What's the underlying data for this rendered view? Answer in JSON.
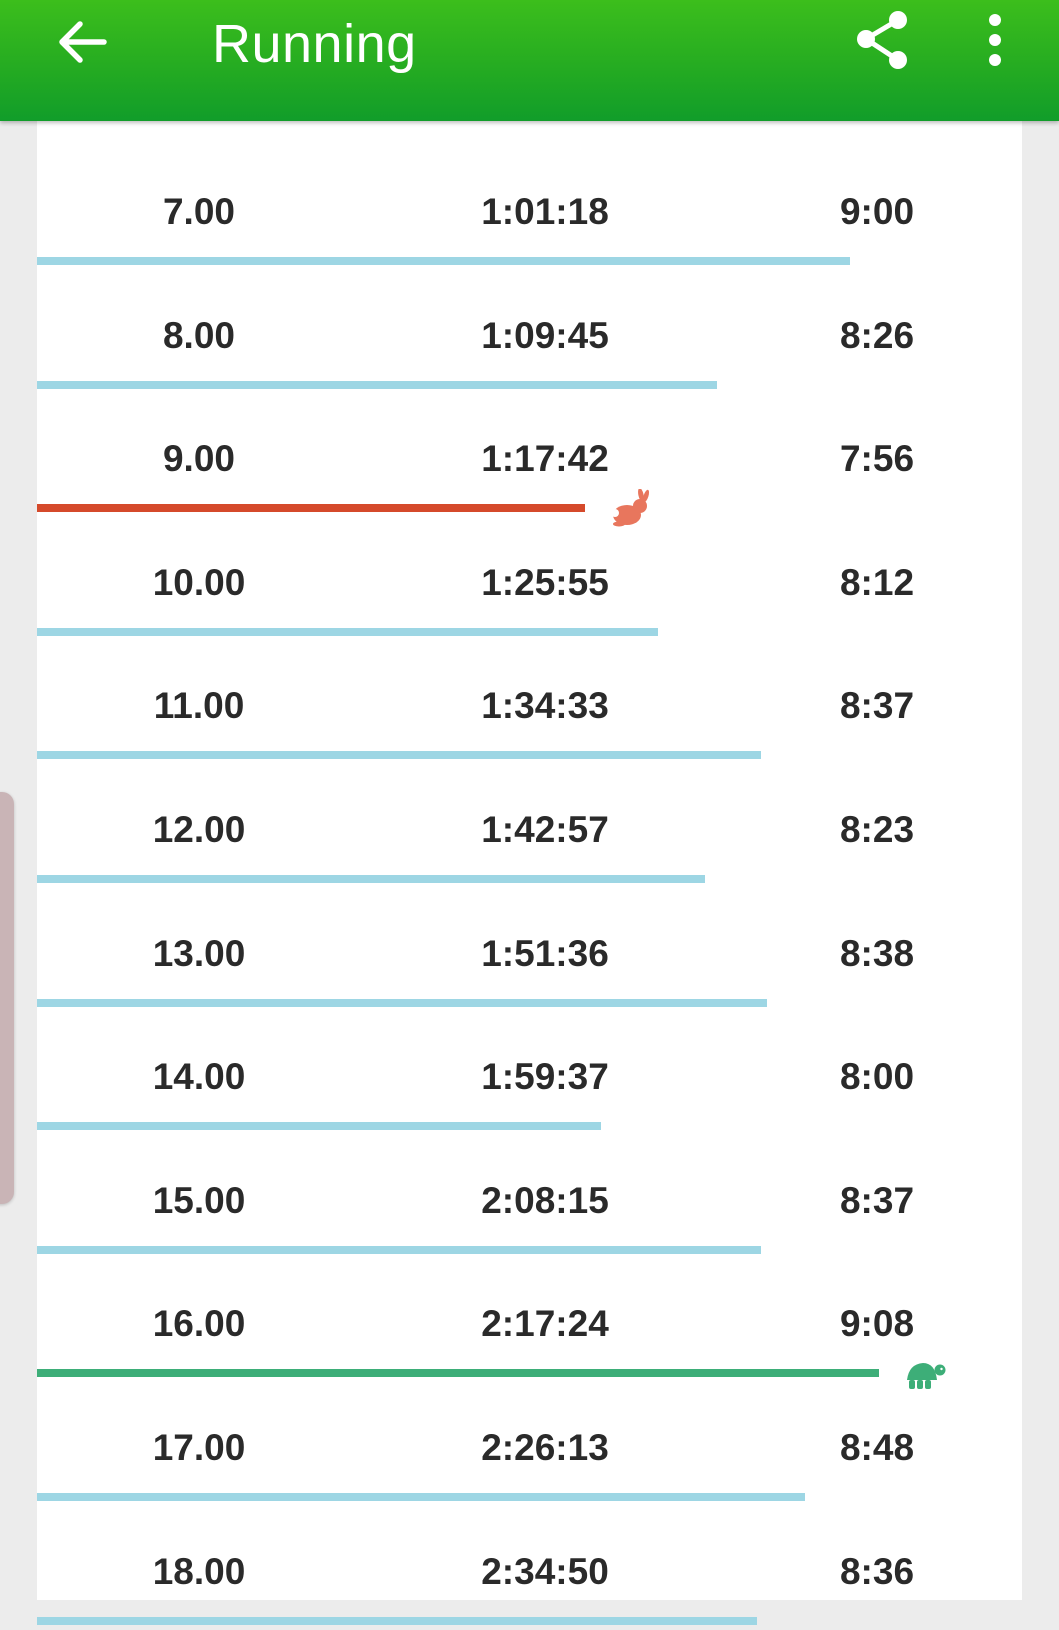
{
  "appbar": {
    "title": "Running",
    "back_icon": "arrow-left-icon",
    "share_icon": "share-icon",
    "more_icon": "more-vert-icon"
  },
  "colors": {
    "appbar": "#23aa22",
    "bar_normal": "#9dd6e4",
    "bar_fastest": "#d54a2b",
    "bar_slowest": "#3dae78",
    "rabbit": "#e8765d",
    "turtle": "#3dae78"
  },
  "splits": [
    {
      "distance": "7.00",
      "elapsed": "1:01:18",
      "pace": "9:00",
      "bar_fraction": 0.825,
      "kind": "normal"
    },
    {
      "distance": "8.00",
      "elapsed": "1:09:45",
      "pace": "8:26",
      "bar_fraction": 0.69,
      "kind": "normal"
    },
    {
      "distance": "9.00",
      "elapsed": "1:17:42",
      "pace": "7:56",
      "bar_fraction": 0.556,
      "kind": "fastest",
      "marker": "rabbit-icon"
    },
    {
      "distance": "10.00",
      "elapsed": "1:25:55",
      "pace": "8:12",
      "bar_fraction": 0.63,
      "kind": "normal"
    },
    {
      "distance": "11.00",
      "elapsed": "1:34:33",
      "pace": "8:37",
      "bar_fraction": 0.735,
      "kind": "normal"
    },
    {
      "distance": "12.00",
      "elapsed": "1:42:57",
      "pace": "8:23",
      "bar_fraction": 0.678,
      "kind": "normal"
    },
    {
      "distance": "13.00",
      "elapsed": "1:51:36",
      "pace": "8:38",
      "bar_fraction": 0.741,
      "kind": "normal"
    },
    {
      "distance": "14.00",
      "elapsed": "1:59:37",
      "pace": "8:00",
      "bar_fraction": 0.573,
      "kind": "normal"
    },
    {
      "distance": "15.00",
      "elapsed": "2:08:15",
      "pace": "8:37",
      "bar_fraction": 0.735,
      "kind": "normal"
    },
    {
      "distance": "16.00",
      "elapsed": "2:17:24",
      "pace": "9:08",
      "bar_fraction": 0.855,
      "kind": "slowest",
      "marker": "turtle-icon"
    },
    {
      "distance": "17.00",
      "elapsed": "2:26:13",
      "pace": "8:48",
      "bar_fraction": 0.78,
      "kind": "normal"
    },
    {
      "distance": "18.00",
      "elapsed": "2:34:50",
      "pace": "8:36",
      "bar_fraction": 0.731,
      "kind": "normal"
    }
  ]
}
